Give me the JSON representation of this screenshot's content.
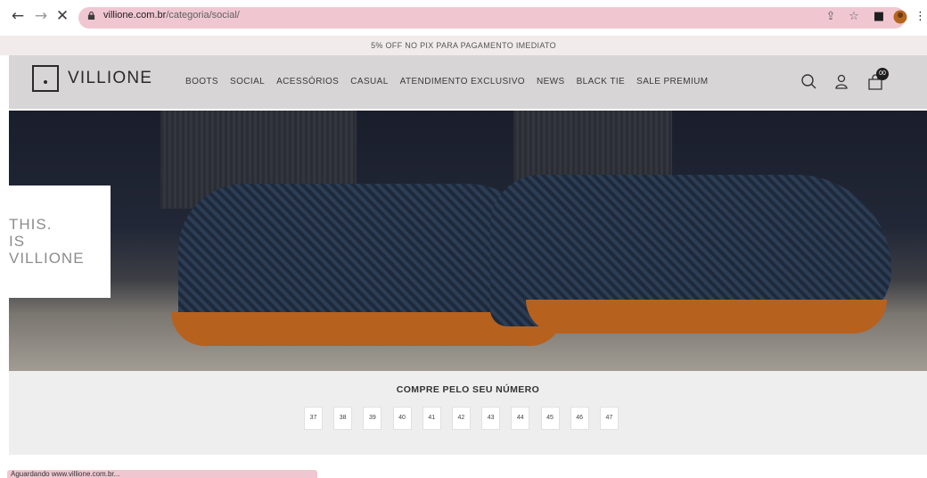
{
  "browser": {
    "url_domain": "villione.com.br",
    "url_path": "/categoria/social/",
    "status_text": "Aguardando www.villione.com.br..."
  },
  "announcement": "5% OFF NO PIX PARA PAGAMENTO IMEDIATO",
  "header": {
    "logo_text": "VILLIONE",
    "menu": [
      "BOOTS",
      "SOCIAL",
      "ACESSÓRIOS",
      "CASUAL",
      "ATENDIMENTO EXCLUSIVO",
      "NEWS",
      "BLACK TIE",
      "SALE PREMIUM"
    ],
    "cart_count": "00"
  },
  "hero": {
    "lines": [
      "THIS.",
      "IS",
      "VILLIONE"
    ]
  },
  "sizes": {
    "title": "COMPRE PELO SEU NÚMERO",
    "options": [
      "37",
      "38",
      "39",
      "40",
      "41",
      "42",
      "43",
      "44",
      "45",
      "46",
      "47"
    ]
  },
  "colors": {
    "url_bar": "#f0c7d1",
    "header_bg": "#d8d5d6",
    "announcement_bg": "#f1eceb"
  }
}
